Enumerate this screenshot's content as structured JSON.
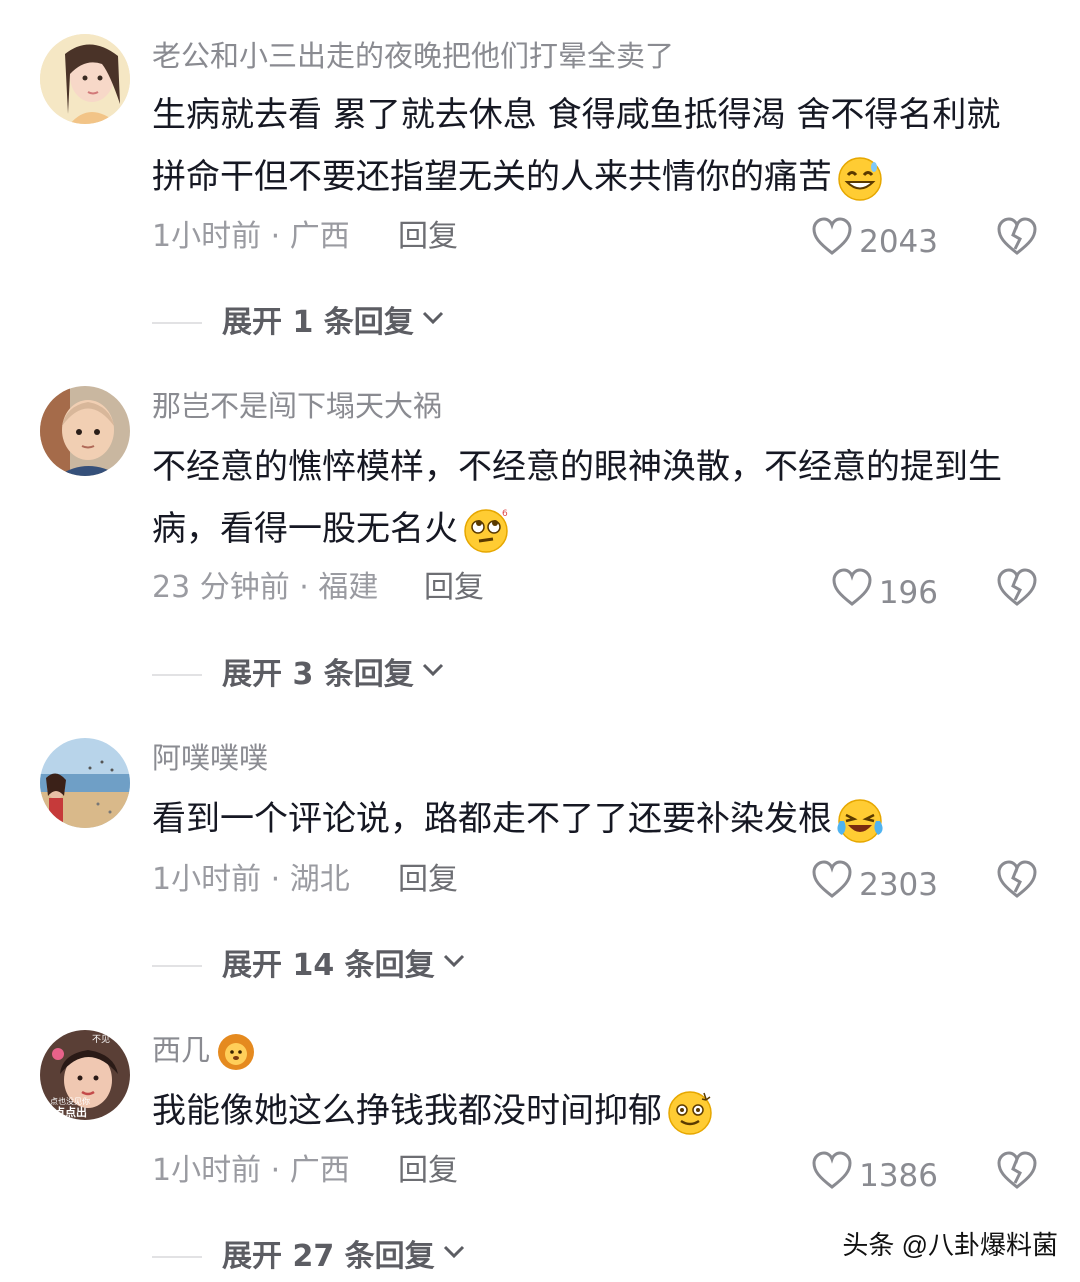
{
  "comments": [
    {
      "username": "老公和小三出走的夜晚把他们打晕全卖了",
      "text": "生病就去看  累了就去休息  食得咸鱼抵得渴  舍不得名利就拼命干但不要还指望无关的人来共情你的痛苦",
      "emoji": "grinning-sweat-emoji",
      "time_location": "1小时前 · 广西",
      "reply_label": "回复",
      "likes": "2043",
      "expand_label": "展开 1 条回复"
    },
    {
      "username": "那岂不是闯下塌天大祸",
      "text": "不经意的憔悴模样，不经意的眼神涣散，不经意的提到生病，看得一股无名火",
      "emoji": "eye-roll-emoji",
      "time_location": "23 分钟前 · 福建",
      "reply_label": "回复",
      "likes": "196",
      "expand_label": "展开 3 条回复"
    },
    {
      "username": "阿噗噗噗",
      "text": "看到一个评论说，路都走不了了还要补染发根",
      "emoji": "crying-laughing-emoji",
      "time_location": "1小时前 · 湖北",
      "reply_label": "回复",
      "likes": "2303",
      "expand_label": "展开 14 条回复"
    },
    {
      "username": "西几",
      "username_badge": "lion-emoji",
      "text": "我能像她这么挣钱我都没时间抑郁",
      "emoji": "dizzy-smile-emoji",
      "time_location": "1小时前 · 广西",
      "reply_label": "回复",
      "likes": "1386",
      "expand_label": "展开 27 条回复"
    }
  ],
  "avatar4_text": [
    "不见",
    "点也没见你",
    "点点出"
  ],
  "watermark": "头条 @八卦爆料菌"
}
